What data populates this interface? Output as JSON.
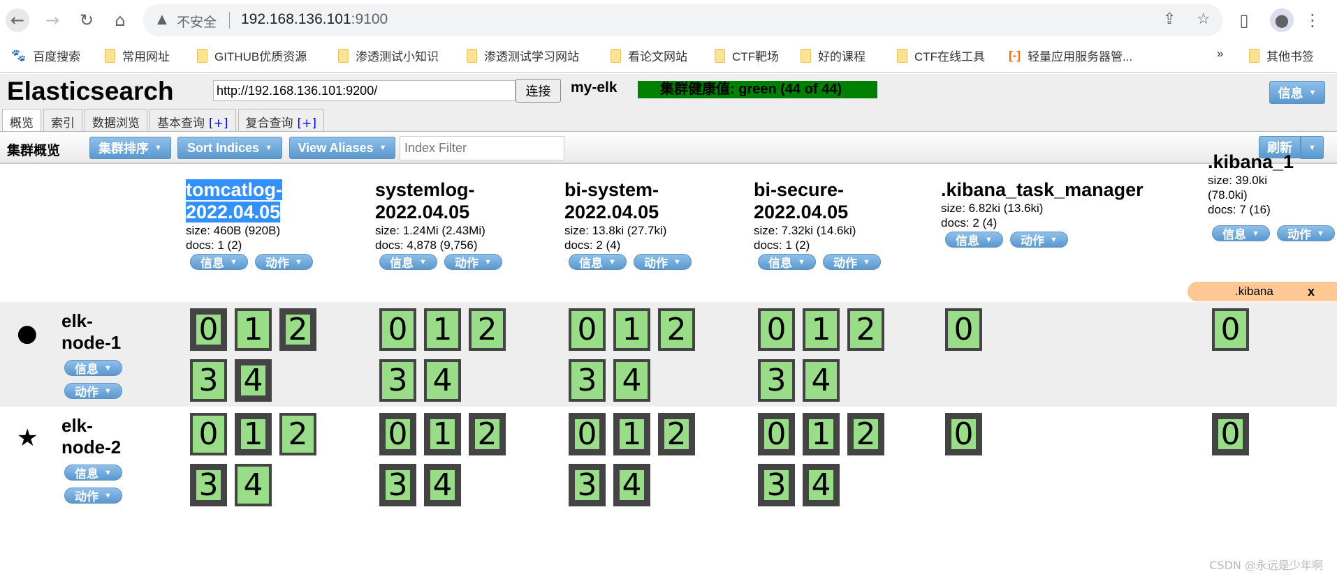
{
  "browser": {
    "insecure_label": "不安全",
    "url_host": "192.168.136.101",
    "url_port": ":9100"
  },
  "bookmarks": [
    "百度搜索",
    "常用网址",
    "GITHUB优质资源",
    "渗透测试小知识",
    "渗透测试学习网站",
    "看论文网站",
    "CTF靶场",
    "好的课程",
    "CTF在线工具",
    "轻量应用服务器管...",
    "其他书签"
  ],
  "bookmarks_more": "»",
  "header": {
    "logo": "Elasticsearch",
    "url": "http://192.168.136.101:9200/",
    "connect": "连接",
    "cluster_name": "my-elk",
    "health": "集群健康值: green (44 of 44)",
    "health_color": "#008000",
    "info": "信息"
  },
  "tabs": [
    {
      "label": "概览"
    },
    {
      "label": "索引"
    },
    {
      "label": "数据浏览"
    },
    {
      "label": "基本查询",
      "plus": "[+]"
    },
    {
      "label": "复合查询",
      "plus": "[+]"
    }
  ],
  "toolbar": {
    "title": "集群概览",
    "sort_cluster": "集群排序",
    "sort_indices": "Sort Indices",
    "view_aliases": "View Aliases",
    "filter_placeholder": "Index Filter",
    "refresh": "刷新"
  },
  "buttons": {
    "info": "信息",
    "action": "动作"
  },
  "indices": [
    {
      "name1": "tomcatlog-",
      "name2": "2022.04.05",
      "size": "size: 460B (920B)",
      "docs": "docs: 1 (2)",
      "selected": true
    },
    {
      "name1": "systemlog-",
      "name2": "2022.04.05",
      "size": "size: 1.24Mi (2.43Mi)",
      "docs": "docs: 4,878 (9,756)"
    },
    {
      "name1": "bi-system-",
      "name2": "2022.04.05",
      "size": "size: 13.8ki (27.7ki)",
      "docs": "docs: 2 (4)"
    },
    {
      "name1": "bi-secure-",
      "name2": "2022.04.05",
      "size": "size: 7.32ki (14.6ki)",
      "docs": "docs: 1 (2)"
    },
    {
      "name1": ".kibana_task_manager",
      "name2": "",
      "size": "size: 6.82ki (13.6ki)",
      "docs": "docs: 2 (4)"
    },
    {
      "name1": ".kibana_1",
      "name2": "",
      "size": "size: 39.0ki (78.0ki)",
      "docs": "docs: 7 (16)"
    }
  ],
  "alias": {
    "name": ".kibana",
    "close": "x"
  },
  "nodes": [
    {
      "name1": "elk-",
      "name2": "node-1",
      "icon": "circle-icon",
      "shards": [
        [
          [
            0,
            1
          ],
          [
            1,
            0
          ],
          [
            2,
            1
          ],
          [
            3,
            0
          ],
          [
            4,
            1
          ]
        ],
        [
          [
            0,
            0
          ],
          [
            1,
            0
          ],
          [
            2,
            0
          ],
          [
            3,
            0
          ],
          [
            4,
            0
          ]
        ],
        [
          [
            0,
            0
          ],
          [
            1,
            0
          ],
          [
            2,
            0
          ],
          [
            3,
            0
          ],
          [
            4,
            0
          ]
        ],
        [
          [
            0,
            0
          ],
          [
            1,
            0
          ],
          [
            2,
            0
          ],
          [
            3,
            0
          ],
          [
            4,
            0
          ]
        ],
        [
          [
            0,
            0
          ]
        ],
        [
          [
            0,
            0
          ]
        ]
      ]
    },
    {
      "name1": "elk-",
      "name2": "node-2",
      "icon": "star-icon",
      "shards": [
        [
          [
            0,
            0
          ],
          [
            1,
            1
          ],
          [
            2,
            0
          ],
          [
            3,
            1
          ],
          [
            4,
            0
          ]
        ],
        [
          [
            0,
            1
          ],
          [
            1,
            1
          ],
          [
            2,
            1
          ],
          [
            3,
            1
          ],
          [
            4,
            1
          ]
        ],
        [
          [
            0,
            1
          ],
          [
            1,
            1
          ],
          [
            2,
            1
          ],
          [
            3,
            1
          ],
          [
            4,
            1
          ]
        ],
        [
          [
            0,
            1
          ],
          [
            1,
            1
          ],
          [
            2,
            1
          ],
          [
            3,
            1
          ],
          [
            4,
            1
          ]
        ],
        [
          [
            0,
            1
          ]
        ],
        [
          [
            0,
            1
          ]
        ]
      ]
    }
  ],
  "watermark": "CSDN @永远是少年啊"
}
